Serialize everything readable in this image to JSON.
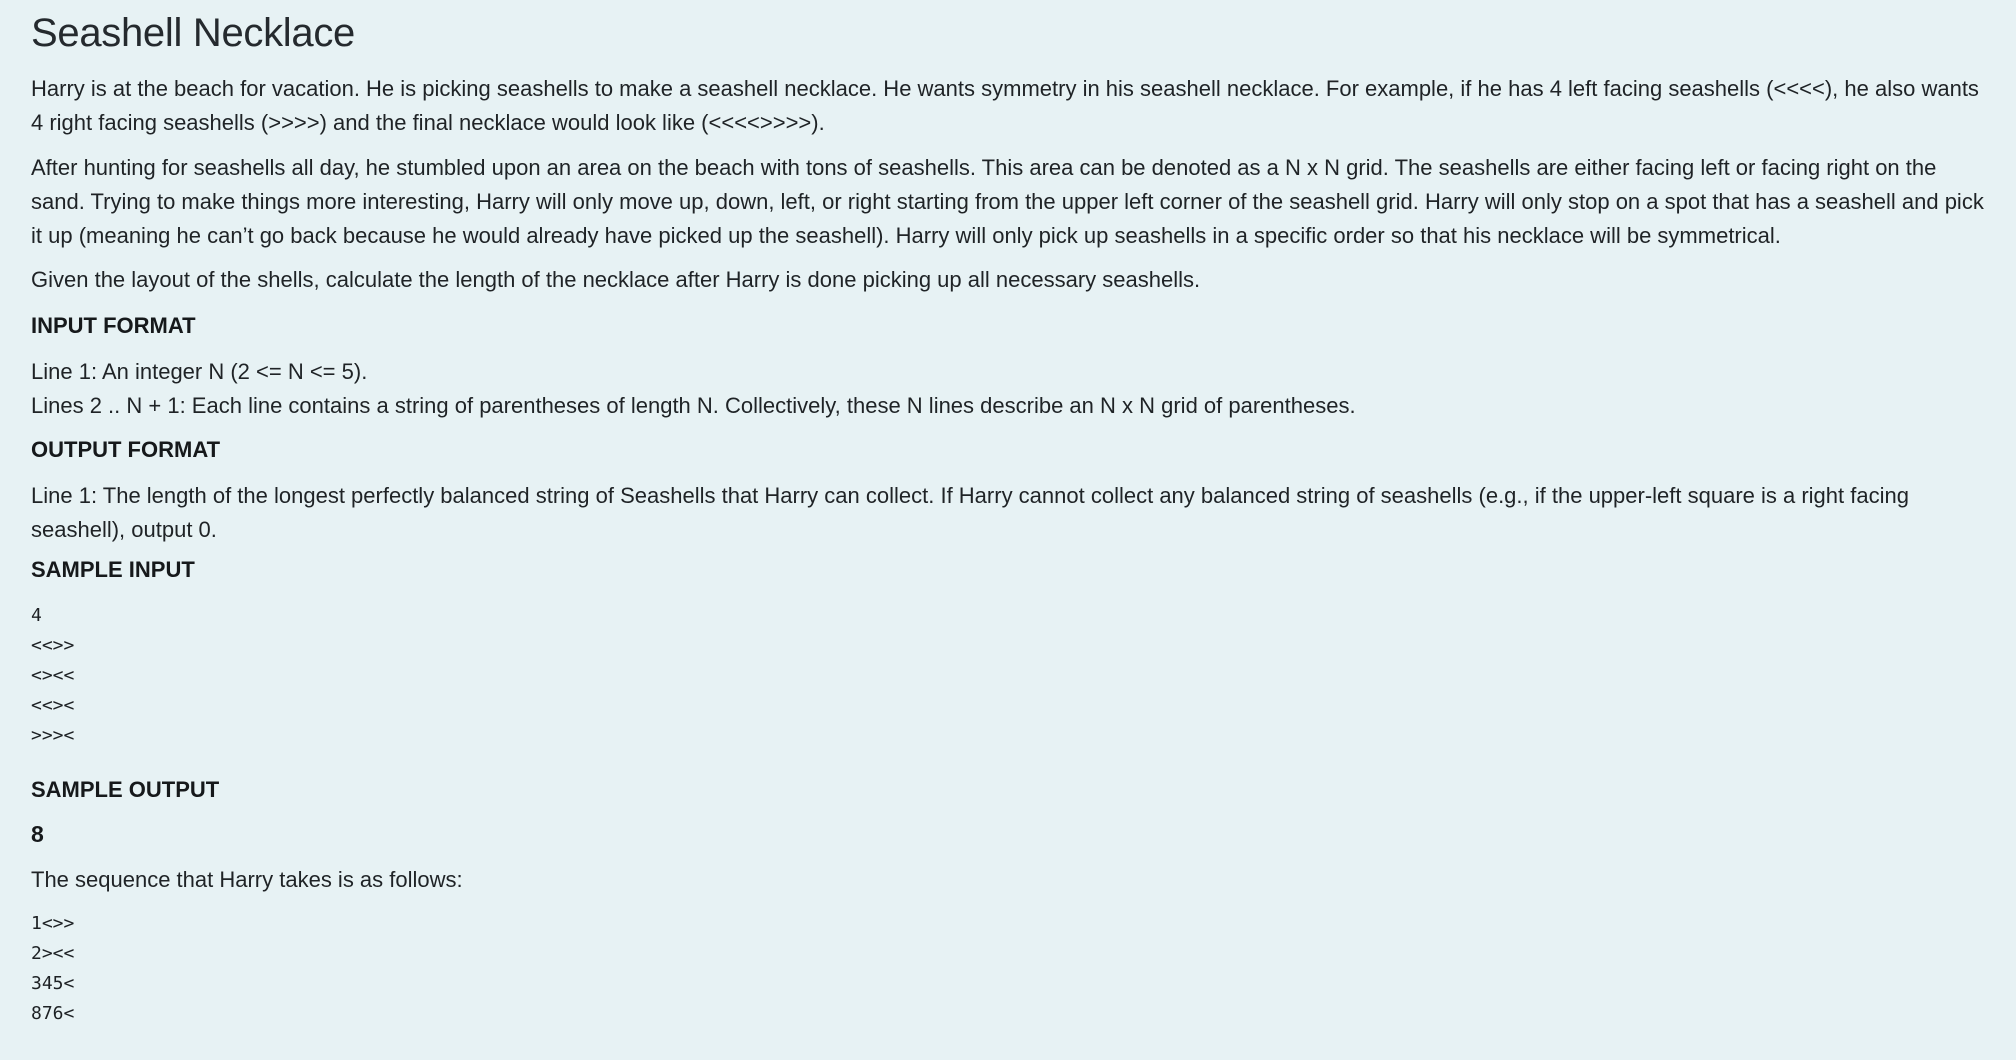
{
  "title": "Seashell Necklace",
  "paragraphs": [
    "Harry is at the beach for vacation. He is picking seashells to make a seashell necklace. He wants symmetry in his seashell necklace. For example, if he has 4 left facing seashells (<<<<), he also wants 4 right facing seashells (>>>>) and the final necklace would look like (<<<<>>>>).",
    "After hunting for seashells all day, he stumbled upon an area on the beach with tons of seashells. This area can be denoted as a N x N grid. The seashells are either facing left or facing right on the sand. Trying to make things more interesting, Harry will only move up, down, left, or right starting from the upper left corner of the seashell grid. Harry will only stop on a spot that has a seashell and pick it up (meaning he can’t go back because he would already have picked up the seashell). Harry will only pick up seashells in a specific order so that his necklace will be symmetrical.",
    "Given the layout of the shells, calculate the length of the necklace after Harry is done picking up all necessary seashells."
  ],
  "input_format": {
    "heading": "INPUT FORMAT",
    "lines": [
      "Line 1: An integer N (2 <= N <= 5).",
      "Lines 2 .. N + 1: Each line contains a string of parentheses of length N. Collectively, these N lines describe an N x N grid of parentheses."
    ]
  },
  "output_format": {
    "heading": "OUTPUT FORMAT",
    "text": "Line 1: The length of the longest perfectly balanced string of Seashells that Harry can collect.  If Harry cannot collect any balanced string of seashells (e.g., if the upper-left square is a right facing seashell), output 0."
  },
  "sample_input": {
    "heading": "SAMPLE INPUT",
    "lines": [
      "4",
      "<<>>",
      "<><<",
      "<<><",
      ">>><"
    ]
  },
  "sample_output": {
    "heading": "SAMPLE OUTPUT",
    "value": "8",
    "explanation": "The sequence that Harry takes is as follows:",
    "sequence": [
      "1<>>",
      "2><<",
      "345<",
      "876<"
    ]
  }
}
